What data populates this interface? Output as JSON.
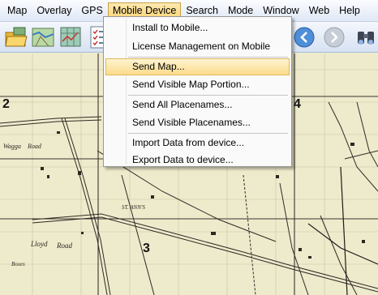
{
  "menubar": {
    "items": [
      "Map",
      "Overlay",
      "GPS",
      "Mobile Device",
      "Search",
      "Mode",
      "Window",
      "Web",
      "Help"
    ],
    "active_index": 3
  },
  "toolbar": {
    "icons": [
      "open-folder-icon",
      "map-icon",
      "map-layers-icon",
      "checklist-icon",
      "back-arrow-icon",
      "forward-arrow-icon",
      "binoculars-icon"
    ]
  },
  "dropdown": {
    "items": [
      "Install to Mobile...",
      "License Management on Mobile",
      "Send Map...",
      "Send Visible Map Portion...",
      "Send All Placenames...",
      "Send Visible Placenames...",
      "Import Data from device...",
      "Export Data to device..."
    ],
    "highlighted_index": 2
  },
  "map": {
    "grid_numbers": [
      "2",
      "3",
      "4"
    ],
    "labels": [
      "Lloyd",
      "Road",
      "Boxes",
      "Wagga",
      "Road",
      "ST. ANN'S"
    ]
  },
  "colors": {
    "menubar_bg": "#dfe8f6",
    "highlight": "#fbdc8c",
    "map_bg": "#eeeacc"
  }
}
